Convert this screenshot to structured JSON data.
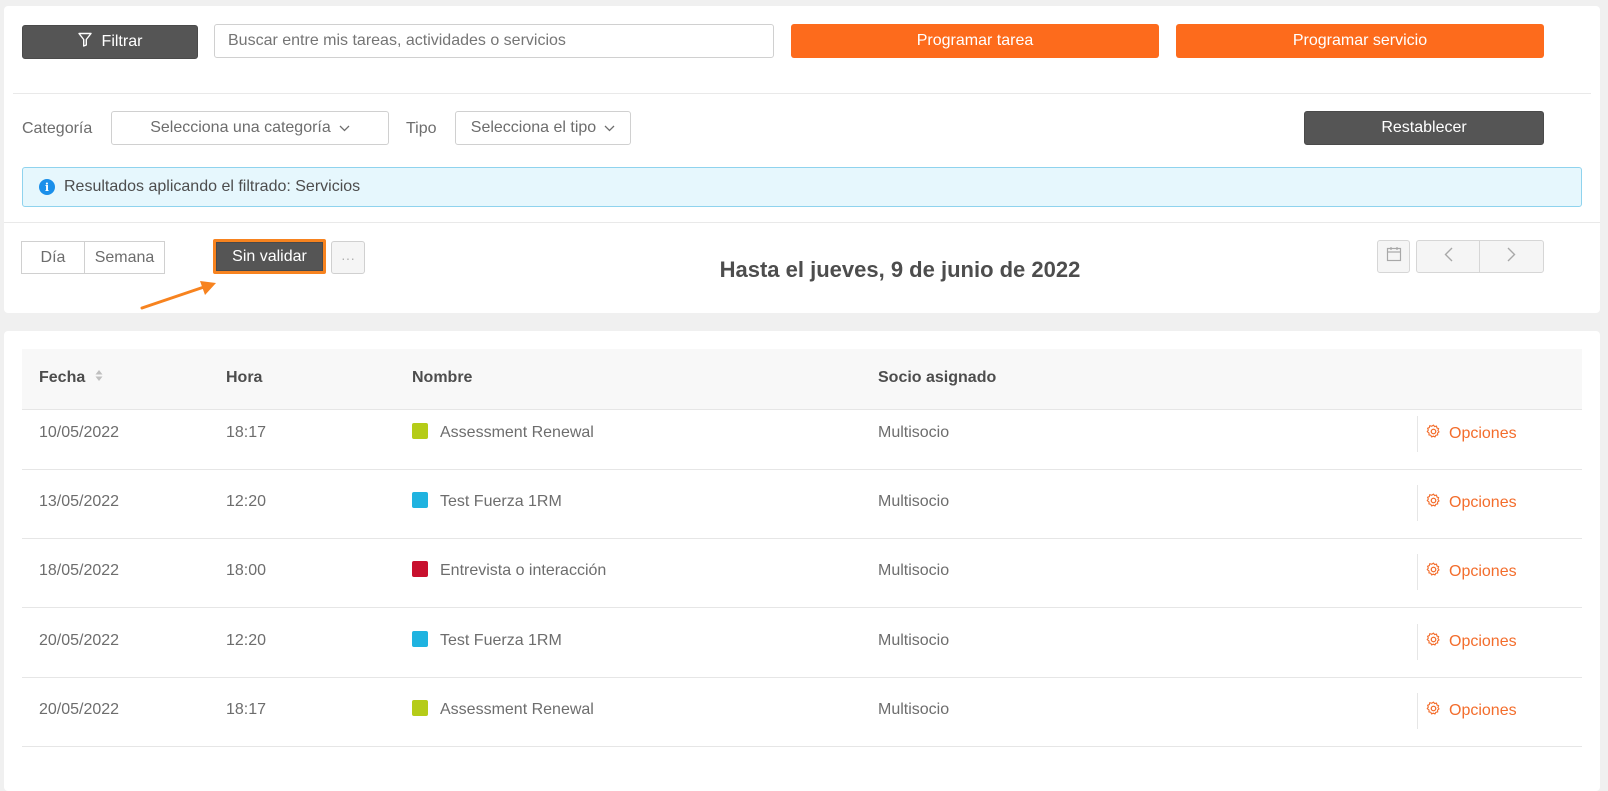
{
  "toolbar": {
    "filter_label": "Filtrar",
    "search_placeholder": "Buscar entre mis tareas, actividades o servicios",
    "schedule_task_label": "Programar tarea",
    "schedule_service_label": "Programar servicio"
  },
  "filters": {
    "category_label": "Categoría",
    "category_value": "Selecciona una categoría",
    "type_label": "Tipo",
    "type_value": "Selecciona el tipo",
    "reset_label": "Restablecer"
  },
  "alert": {
    "text": "Resultados aplicando el filtrado: Servicios"
  },
  "view": {
    "day_label": "Día",
    "week_label": "Semana",
    "unvalidated_label": "Sin validar",
    "more_label": "···",
    "date_title": "Hasta el jueves, 9 de junio de 2022"
  },
  "table": {
    "headers": {
      "date": "Fecha",
      "time": "Hora",
      "name": "Nombre",
      "partner": "Socio asignado"
    },
    "rows": [
      {
        "date": "10/05/2022",
        "time": "18:17",
        "name": "Assessment Renewal",
        "color": "#b5cc18",
        "partner": "Multisocio",
        "action": "Opciones"
      },
      {
        "date": "13/05/2022",
        "time": "12:20",
        "name": "Test Fuerza 1RM",
        "color": "#1fb3e0",
        "partner": "Multisocio",
        "action": "Opciones"
      },
      {
        "date": "18/05/2022",
        "time": "18:00",
        "name": "Entrevista o interacción",
        "color": "#c8102e",
        "partner": "Multisocio",
        "action": "Opciones"
      },
      {
        "date": "20/05/2022",
        "time": "12:20",
        "name": "Test Fuerza 1RM",
        "color": "#1fb3e0",
        "partner": "Multisocio",
        "action": "Opciones"
      },
      {
        "date": "20/05/2022",
        "time": "18:17",
        "name": "Assessment Renewal",
        "color": "#b5cc18",
        "partner": "Multisocio",
        "action": "Opciones"
      }
    ]
  },
  "colors": {
    "accent": "#fd6b1c",
    "dark": "#555555",
    "highlight": "#f7831f"
  }
}
